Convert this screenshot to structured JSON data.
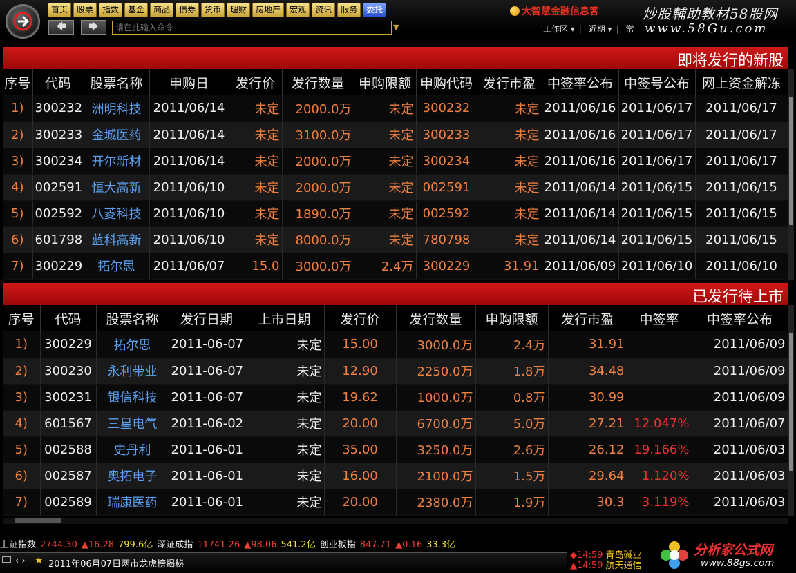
{
  "nav": [
    "首页",
    "股票",
    "指数",
    "基金",
    "商品",
    "债券",
    "货币",
    "理财",
    "房地产",
    "宏观",
    "资讯",
    "服务",
    "委托"
  ],
  "nav_active_index": 12,
  "command": {
    "placeholder": "请在此输入命令"
  },
  "brand": "大智慧金融信息客",
  "watermark": {
    "line1": "炒股輔助教材58股网",
    "line2": "www.58Gu.com"
  },
  "workspace_menu": [
    "工作区 ▾",
    "近期 ▾",
    "常"
  ],
  "upcoming": {
    "title": "即将发行的新股",
    "headers": [
      "序号",
      "代码",
      "股票名称",
      "申购日",
      "发行价",
      "发行数量",
      "申购限额",
      "申购代码",
      "发行市盈",
      "中签率公布",
      "中签号公布",
      "网上资金解冻"
    ],
    "rows": [
      [
        "1)",
        "300232",
        "洲明科技",
        "2011/06/14",
        "未定",
        "2000.0万",
        "未定",
        "300232",
        "未定",
        "2011/06/16",
        "2011/06/17",
        "2011/06/17"
      ],
      [
        "2)",
        "300233",
        "金城医药",
        "2011/06/14",
        "未定",
        "3100.0万",
        "未定",
        "300233",
        "未定",
        "2011/06/16",
        "2011/06/17",
        "2011/06/17"
      ],
      [
        "3)",
        "300234",
        "开尔新材",
        "2011/06/14",
        "未定",
        "2000.0万",
        "未定",
        "300234",
        "未定",
        "2011/06/16",
        "2011/06/17",
        "2011/06/17"
      ],
      [
        "4)",
        "002591",
        "恒大高新",
        "2011/06/10",
        "未定",
        "2000.0万",
        "未定",
        "002591",
        "未定",
        "2011/06/14",
        "2011/06/15",
        "2011/06/15"
      ],
      [
        "5)",
        "002592",
        "八菱科技",
        "2011/06/10",
        "未定",
        "1890.0万",
        "未定",
        "002592",
        "未定",
        "2011/06/14",
        "2011/06/15",
        "2011/06/15"
      ],
      [
        "6)",
        "601798",
        "蓝科高新",
        "2011/06/10",
        "未定",
        "8000.0万",
        "未定",
        "780798",
        "未定",
        "2011/06/14",
        "2011/06/15",
        "2011/06/15"
      ],
      [
        "7)",
        "300229",
        "拓尔思",
        "2011/06/07",
        "15.0",
        "3000.0万",
        "2.4万",
        "300229",
        "31.91",
        "2011/06/09",
        "2011/06/10",
        "2011/06/10"
      ]
    ]
  },
  "issued": {
    "title": "已发行待上市",
    "headers": [
      "序号",
      "代码",
      "股票名称",
      "发行日期",
      "上市日期",
      "发行价",
      "发行数量",
      "申购限额",
      "发行市盈",
      "中签率",
      "中签率公布"
    ],
    "rows": [
      [
        "1)",
        "300229",
        "拓尔思",
        "2011-06-07",
        "未定",
        "15.00",
        "3000.0万",
        "2.4万",
        "31.91",
        "",
        "2011/06/09"
      ],
      [
        "2)",
        "300230",
        "永利带业",
        "2011-06-07",
        "未定",
        "12.90",
        "2250.0万",
        "1.8万",
        "34.48",
        "",
        "2011/06/09"
      ],
      [
        "3)",
        "300231",
        "银信科技",
        "2011-06-07",
        "未定",
        "19.62",
        "1000.0万",
        "0.8万",
        "30.99",
        "",
        "2011/06/09"
      ],
      [
        "4)",
        "601567",
        "三星电气",
        "2011-06-02",
        "未定",
        "20.00",
        "6700.0万",
        "5.0万",
        "27.21",
        "12.047%",
        "2011/06/07"
      ],
      [
        "5)",
        "002588",
        "史丹利",
        "2011-06-01",
        "未定",
        "35.00",
        "3250.0万",
        "2.6万",
        "26.12",
        "19.166%",
        "2011/06/03"
      ],
      [
        "6)",
        "002587",
        "奥拓电子",
        "2011-06-01",
        "未定",
        "16.00",
        "2100.0万",
        "1.5万",
        "29.64",
        "1.120%",
        "2011/06/03"
      ],
      [
        "7)",
        "002589",
        "瑞康医药",
        "2011-06-01",
        "未定",
        "20.00",
        "2380.0万",
        "1.9万",
        "30.3",
        "3.119%",
        "2011/06/03"
      ]
    ]
  },
  "ticker": [
    {
      "name": "上证指数",
      "value": "2744.30",
      "change": "▲16.28",
      "amount": "799.6亿"
    },
    {
      "name": "深证成指",
      "value": "11741.26",
      "change": "▲98.06",
      "amount": "541.2亿"
    },
    {
      "name": "创业板指",
      "value": "847.71",
      "change": "▲0.16",
      "amount": "33.3亿"
    }
  ],
  "news": "2011年06月07日两市龙虎榜揭秘",
  "news_arrows": "‹ ›",
  "alerts": [
    {
      "time": "◆14:59",
      "name": "青岛碱业"
    },
    {
      "time": "▲14:59",
      "name": "航天通信"
    }
  ],
  "logo2": {
    "title": "分析家公式网",
    "url": "www.88gs.com"
  },
  "colors": {
    "header_red": "#c01010",
    "name_blue": "#5aa0f0",
    "num_orange": "#f08040",
    "rate_red": "#f03030"
  }
}
